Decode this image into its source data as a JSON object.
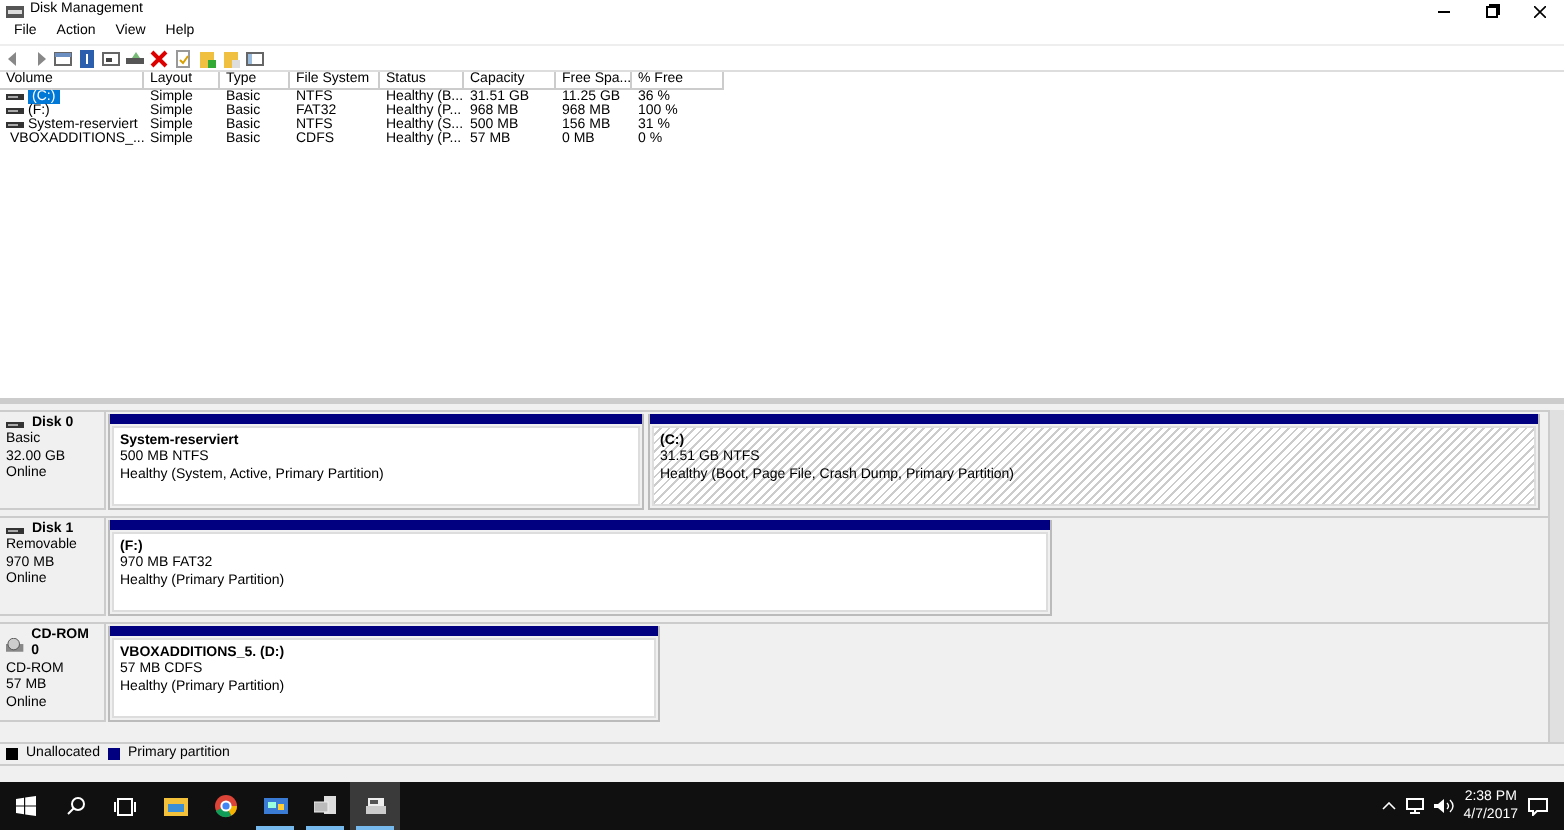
{
  "window": {
    "title": "Disk Management"
  },
  "menu": [
    "File",
    "Action",
    "View",
    "Help"
  ],
  "volumes": {
    "columns": [
      "Volume",
      "Layout",
      "Type",
      "File System",
      "Status",
      "Capacity",
      "Free Spa...",
      "% Free"
    ],
    "rows": [
      {
        "selected": true,
        "kind": "disk",
        "cells": [
          "(C:)",
          "Simple",
          "Basic",
          "NTFS",
          "Healthy (B...",
          "31.51 GB",
          "11.25 GB",
          "36 %"
        ]
      },
      {
        "selected": false,
        "kind": "disk",
        "cells": [
          "(F:)",
          "Simple",
          "Basic",
          "FAT32",
          "Healthy (P...",
          "968 MB",
          "968 MB",
          "100 %"
        ]
      },
      {
        "selected": false,
        "kind": "disk",
        "cells": [
          "System-reserviert",
          "Simple",
          "Basic",
          "NTFS",
          "Healthy (S...",
          "500 MB",
          "156 MB",
          "31 %"
        ]
      },
      {
        "selected": false,
        "kind": "cd",
        "cells": [
          "VBOXADDITIONS_...",
          "Simple",
          "Basic",
          "CDFS",
          "Healthy (P...",
          "57 MB",
          "0 MB",
          "0 %"
        ]
      }
    ]
  },
  "disks": [
    {
      "kind": "disk",
      "name": "Disk 0",
      "type": "Basic",
      "size": "32.00 GB",
      "status": "Online",
      "partitions": [
        {
          "label": "System-reserviert",
          "details": "500 MB NTFS",
          "status": "Healthy (System, Active, Primary Partition)",
          "selected": false
        },
        {
          "label": "(C:)",
          "details": "31.51 GB NTFS",
          "status": "Healthy (Boot, Page File, Crash Dump, Primary Partition)",
          "selected": true
        }
      ]
    },
    {
      "kind": "disk",
      "name": "Disk 1",
      "type": "Removable",
      "size": "970 MB",
      "status": "Online",
      "partitions": [
        {
          "label": "(F:)",
          "details": "970 MB FAT32",
          "status": "Healthy (Primary Partition)",
          "selected": false
        }
      ]
    },
    {
      "kind": "cd",
      "name": "CD-ROM 0",
      "type": "CD-ROM",
      "size": "57 MB",
      "status": "Online",
      "partitions": [
        {
          "label": "VBOXADDITIONS_5.  (D:)",
          "details": "57 MB CDFS",
          "status": "Healthy (Primary Partition)",
          "selected": false
        }
      ]
    }
  ],
  "legend": [
    {
      "label": "Unallocated",
      "color": "#000000"
    },
    {
      "label": "Primary partition",
      "color": "#000080"
    }
  ],
  "taskbar": {
    "apps": [
      {
        "kind": "explorer",
        "running": false,
        "selected": false
      },
      {
        "kind": "chrome",
        "running": false,
        "selected": false
      },
      {
        "kind": "control",
        "running": true,
        "selected": false
      },
      {
        "kind": "computer",
        "running": true,
        "selected": false
      },
      {
        "kind": "diskmgmt",
        "running": true,
        "selected": true
      }
    ],
    "time": "2:38 PM",
    "date": "4/7/2017"
  }
}
